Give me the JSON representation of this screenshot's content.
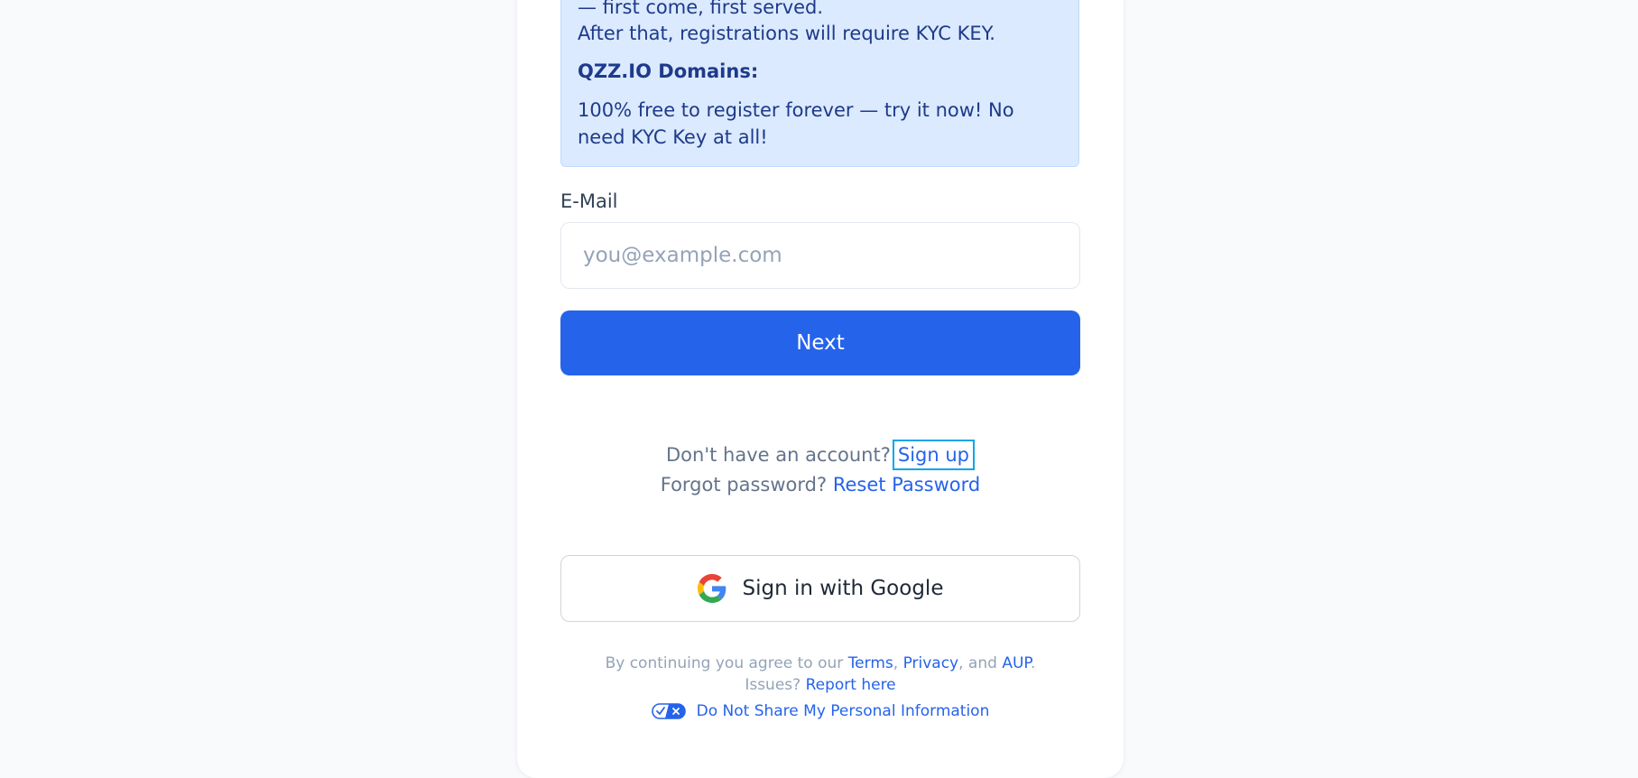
{
  "notice": {
    "line1": "— first come, first served.",
    "line2": "After that, registrations will require KYC KEY.",
    "heading": "QZZ.IO Domains:",
    "body": "100% free to register forever — try it now! No need KYC Key at all!"
  },
  "form": {
    "email_label": "E-Mail",
    "email_placeholder": "you@example.com",
    "email_value": "",
    "next_label": "Next"
  },
  "links": {
    "no_account_text": "Don't have an account?",
    "signup_label": "Sign up",
    "forgot_text": "Forgot password?",
    "reset_label": "Reset Password"
  },
  "google": {
    "label": "Sign in with Google",
    "icon": "google-logo-icon"
  },
  "legal": {
    "prefix": "By continuing you agree to our",
    "terms": "Terms",
    "comma": ",",
    "privacy": "Privacy",
    "and": ", and",
    "aup": "AUP",
    "period": ".",
    "issues_text": "Issues?",
    "report_label": "Report here",
    "privacy_choice_label": "Do Not Share My Personal Information",
    "privacy_icon": "privacy-choices-icon"
  },
  "colors": {
    "accent": "#2563eb",
    "notice_bg": "#dbeafe",
    "notice_text": "#1e3a8a",
    "page_bg": "#f8fafc",
    "focus_outline": "#0ea5e9"
  }
}
